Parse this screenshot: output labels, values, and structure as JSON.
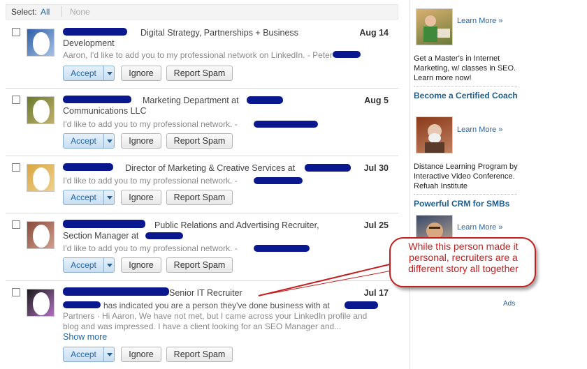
{
  "select_bar": {
    "label": "Select:",
    "all": "All",
    "none": "None"
  },
  "invitations": [
    {
      "title": "Digital Strategy, Partnerships + Business Development",
      "message": "Aaron, I'd like to add you to my professional network on LinkedIn. - Peter",
      "date": "Aug 14"
    },
    {
      "title": "Marketing Department at",
      "title_tail": "Communications LLC",
      "message": "I'd like to add you to my professional network. -",
      "date": "Aug 5"
    },
    {
      "title": "Director of Marketing & Creative Services at",
      "message": "I'd like to add you to my professional network. -",
      "date": "Jul 30"
    },
    {
      "title": "Public Relations and Advertising Recruiter, Section Manager at",
      "message": "I'd like to add you to my professional network. -",
      "date": "Jul 25"
    },
    {
      "title": "Senior IT Recruiter",
      "message_1": "has indicated you are a person they've done business with at",
      "message_2": "Partners · Hi Aaron, We have not met, but I came across your LinkedIn profile and blog and was impressed. I have a client looking for an SEO Manager and...",
      "show_more": "Show more",
      "date": "Jul 17"
    }
  ],
  "buttons": {
    "accept": "Accept",
    "ignore": "Ignore",
    "report_spam": "Report Spam"
  },
  "ads": [
    {
      "learn_more": "Learn More »",
      "text": "Get a Master's in Internet Marketing, w/ classes in SEO. Learn more now!"
    },
    {
      "headline": "Become a Certified Coach",
      "learn_more": "Learn More »",
      "text": "Distance Learning Program by Interactive Video Conference. Refuah Institute"
    },
    {
      "headline": "Powerful CRM for SMBs",
      "learn_more": "Learn More »"
    }
  ],
  "ads_label": "Ads",
  "callout": {
    "text": "While this person made it personal, recruiters are a different story all together"
  },
  "colors": {
    "link": "#2266aa",
    "redaction": "#0a1890",
    "callout": "#c41e1e"
  }
}
